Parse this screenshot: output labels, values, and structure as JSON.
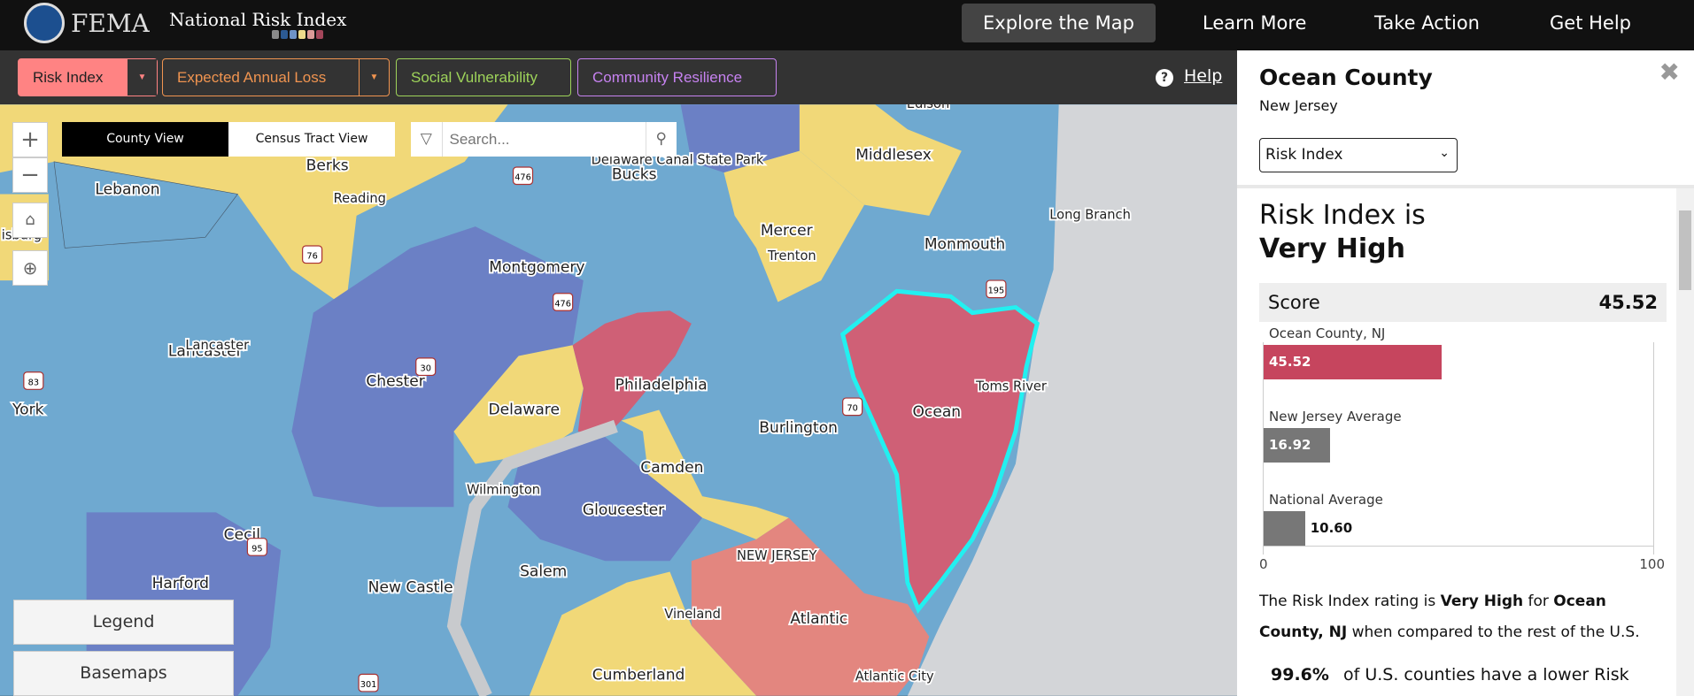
{
  "header": {
    "logo": "FEMA",
    "app_title": "National Risk Index",
    "swatches": [
      "#8a8a8a",
      "#2c5a93",
      "#6e93c6",
      "#efdc8c",
      "#dd9a98",
      "#a4465a"
    ],
    "nav": [
      "Explore the Map",
      "Learn More",
      "Take Action",
      "Get Help"
    ]
  },
  "toolbar": {
    "layers": [
      {
        "label": "Risk Index",
        "color": "#ff8383"
      },
      {
        "label": "Expected Annual Loss",
        "color": "#f09450"
      },
      {
        "label": "Social Vulnerability",
        "color": "#9ed35a"
      },
      {
        "label": "Community Resilience",
        "color": "#c682f0"
      }
    ],
    "help": "Help"
  },
  "map": {
    "view_toggle": [
      "County View",
      "Census Tract View"
    ],
    "search_placeholder": "Search...",
    "labels": [
      "Berks",
      "Lebanon",
      "Reading",
      "Bucks",
      "Montgomery",
      "Chester",
      "Lancaster",
      "Lancaster",
      "York",
      "isburg",
      "Delaware",
      "Philadelphia",
      "Mercer",
      "Trenton",
      "Middlesex",
      "Edison",
      "Monmouth",
      "Long Branch",
      "Burlington",
      "Ocean",
      "Toms River",
      "Camden",
      "Gloucester",
      "Wilmington",
      "Salem",
      "New Castle",
      "Cecil",
      "Harford",
      "NEW JERSEY",
      "Vineland",
      "Atlantic",
      "Cumberland",
      "Atlantic City",
      "Delaware Canal State Park"
    ],
    "shields": [
      "476",
      "476",
      "76",
      "30",
      "83",
      "195",
      "70",
      "95",
      "301"
    ],
    "colors": {
      "very_high": "#cf6076",
      "rel_high": "#e3867f",
      "moderate": "#f1d878",
      "rel_low": "#6fa9d0",
      "very_low": "#6b80c5",
      "water": "#d3d5d8",
      "selected_outline": "#22f0f0"
    },
    "panels": [
      "Legend",
      "Basemaps"
    ]
  },
  "panel": {
    "title": "Ocean County",
    "state": "New Jersey",
    "select_value": "Risk Index",
    "heading_line1": "Risk Index is",
    "heading_line2": "Very High",
    "score_label": "Score",
    "score_value": "45.52",
    "para": {
      "p1": "The Risk Index rating is ",
      "rating": "Very High",
      "p2": " for ",
      "place": "Ocean County, NJ",
      "p3": " when compared to the rest of the U.S."
    },
    "pct_value": "99.6%",
    "pct_text": " of U.S. counties have a lower Risk"
  },
  "chart_data": {
    "type": "bar",
    "orientation": "horizontal",
    "categories": [
      "Ocean County, NJ",
      "New Jersey Average",
      "National Average"
    ],
    "values": [
      45.52,
      16.92,
      10.6
    ],
    "value_labels": [
      "45.52",
      "16.92",
      "10.60"
    ],
    "colors": [
      "#c6455e",
      "#777777",
      "#777777"
    ],
    "xlim": [
      0,
      100
    ],
    "xticks": [
      "0",
      "100"
    ]
  }
}
